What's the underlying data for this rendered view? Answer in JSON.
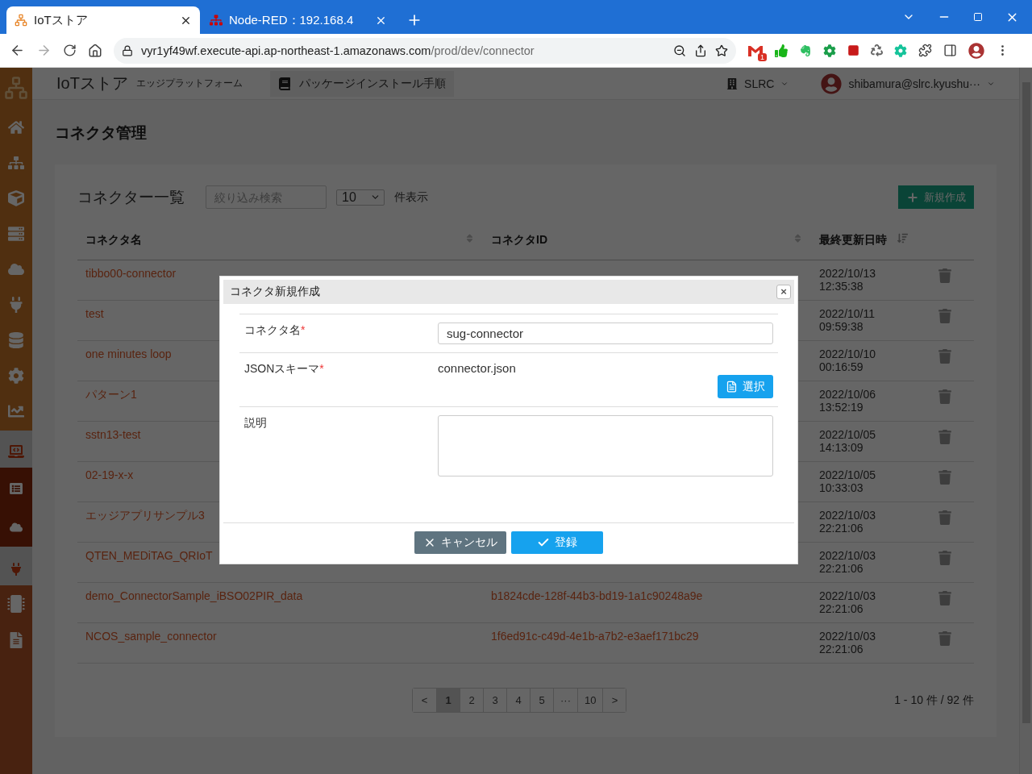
{
  "browser": {
    "tabs": [
      {
        "title": "IoTストア",
        "selected": true
      },
      {
        "title": "Node-RED：192.168.4",
        "selected": false
      }
    ],
    "address": {
      "host": "vyr1yf49wf.execute-api.ap-northeast-1.amazonaws.com",
      "path": "/prod/dev/connector"
    },
    "extension_badge": "1"
  },
  "header": {
    "title": "IoTストア",
    "subtitle": "エッジプラットフォーム",
    "guide_button": "パッケージインストール手順",
    "org": "SLRC",
    "user": "shibamura@slrc.kyushu···"
  },
  "page_title": "コネクタ管理",
  "list": {
    "title": "コネクター一覧",
    "search": {
      "placeholder": "絞り込み検索"
    },
    "page_size": "10",
    "page_size_label": "件表示",
    "new_button": "新規作成"
  },
  "table": {
    "columns": [
      {
        "label": "コネクタ名",
        "kind": "sortable"
      },
      {
        "label": "コネクタID",
        "kind": "sortable"
      },
      {
        "label": "最終更新日時",
        "kind": "sorted"
      }
    ],
    "rows": [
      {
        "name": "tibbo00-connector",
        "updated": "2022/10/13 12:35:38"
      },
      {
        "name": "test",
        "updated": "2022/10/11 09:59:38"
      },
      {
        "name": "one minutes loop",
        "updated": "2022/10/10 00:16:59"
      },
      {
        "name": "パターン1",
        "updated": "2022/10/06 13:52:19"
      },
      {
        "name": "sstn13-test",
        "updated": "2022/10/05 14:13:09"
      },
      {
        "name": "02-19-x-x",
        "updated": "2022/10/05 10:33:03"
      },
      {
        "name": "エッジアプリサンプル3",
        "updated": "2022/10/03 22:21:06"
      },
      {
        "name": "QTEN_MEDiTAG_QRIoT",
        "updated": "2022/10/03 22:21:06"
      },
      {
        "name": "demo_ConnectorSample_iBSO02PIR_data",
        "id": "b1824cde-128f-44b3-bd19-1a1c90248a9e",
        "updated": "2022/10/03 22:21:06"
      },
      {
        "name": "NCOS_sample_connector",
        "id": "1f6ed91c-c49d-4e1b-a7b2-e3aef171bc29",
        "updated": "2022/10/03 22:21:06"
      }
    ]
  },
  "pagination": {
    "pages": [
      {
        "label": "<",
        "selected": false
      },
      {
        "label": "1",
        "selected": true
      },
      {
        "label": "2",
        "selected": false
      },
      {
        "label": "3",
        "selected": false
      },
      {
        "label": "4",
        "selected": false
      },
      {
        "label": "5",
        "selected": false
      },
      {
        "label": "···",
        "selected": false
      },
      {
        "label": "10",
        "selected": false
      },
      {
        "label": ">",
        "selected": false
      }
    ],
    "summary": "1 - 10 件 / 92 件"
  },
  "modal": {
    "title": "コネクタ新規作成",
    "close": "×",
    "fields": [
      {
        "kind": "input",
        "label": "コネクタ名",
        "required_mark": "*",
        "value": "sug-connector"
      },
      {
        "kind": "file",
        "label": "JSONスキーマ",
        "required_mark": "*",
        "value": "connector.json",
        "button": "選択"
      },
      {
        "kind": "textarea",
        "label": "説明"
      }
    ],
    "cancel": "キャンセル",
    "submit": "登録"
  }
}
